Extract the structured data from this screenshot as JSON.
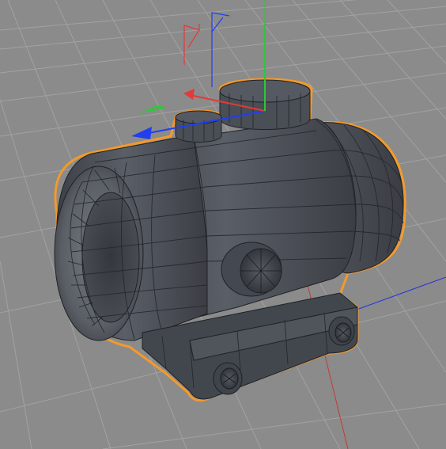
{
  "viewport": {
    "background": "#8b8b8b",
    "grid_color": "#a2a2a2",
    "selection_outline_color": "#f39a2b",
    "mesh_base_color": "#4b4f56",
    "wire_color": "#1f2226"
  },
  "axes": {
    "x_color": "#e23a3a",
    "y_color": "#2fc63a",
    "z_color": "#1f3ff1"
  },
  "object": {
    "type": "red-dot-sight",
    "selected": true
  }
}
